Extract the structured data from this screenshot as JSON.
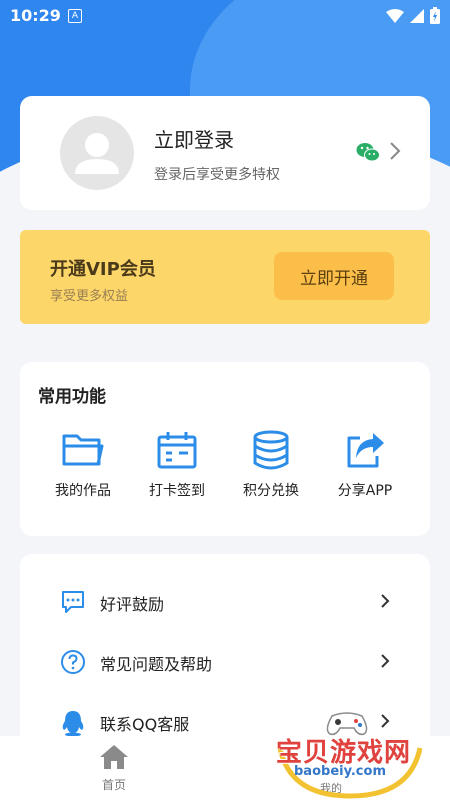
{
  "status_bar": {
    "time": "10:29",
    "notif_icon_letter": "A"
  },
  "profile": {
    "title": "立即登录",
    "subtitle": "登录后享受更多特权",
    "avatar_icon": "person-icon",
    "login_icon": "wechat-icon"
  },
  "vip": {
    "title": "开通VIP会员",
    "subtitle": "享受更多权益",
    "button_label": "立即开通",
    "accent": "#fdd669"
  },
  "functions": {
    "title": "常用功能",
    "items": [
      {
        "label": "我的作品",
        "icon": "folder-icon"
      },
      {
        "label": "打卡签到",
        "icon": "calendar-icon"
      },
      {
        "label": "积分兑换",
        "icon": "database-icon"
      },
      {
        "label": "分享APP",
        "icon": "share-icon"
      }
    ]
  },
  "menu_list": [
    {
      "label": "好评鼓励",
      "icon": "chat-bubble-icon"
    },
    {
      "label": "常见问题及帮助",
      "icon": "question-icon"
    },
    {
      "label": "联系QQ客服",
      "icon": "qq-icon"
    }
  ],
  "bottom_nav": {
    "home_label": "首页",
    "mine_label": "我的"
  },
  "watermark": {
    "main": "宝贝游戏网",
    "sub": "baobeiy.com"
  },
  "colors": {
    "primary": "#2f86ee",
    "icon_blue": "#2b8de8",
    "vip": "#fdd669"
  }
}
